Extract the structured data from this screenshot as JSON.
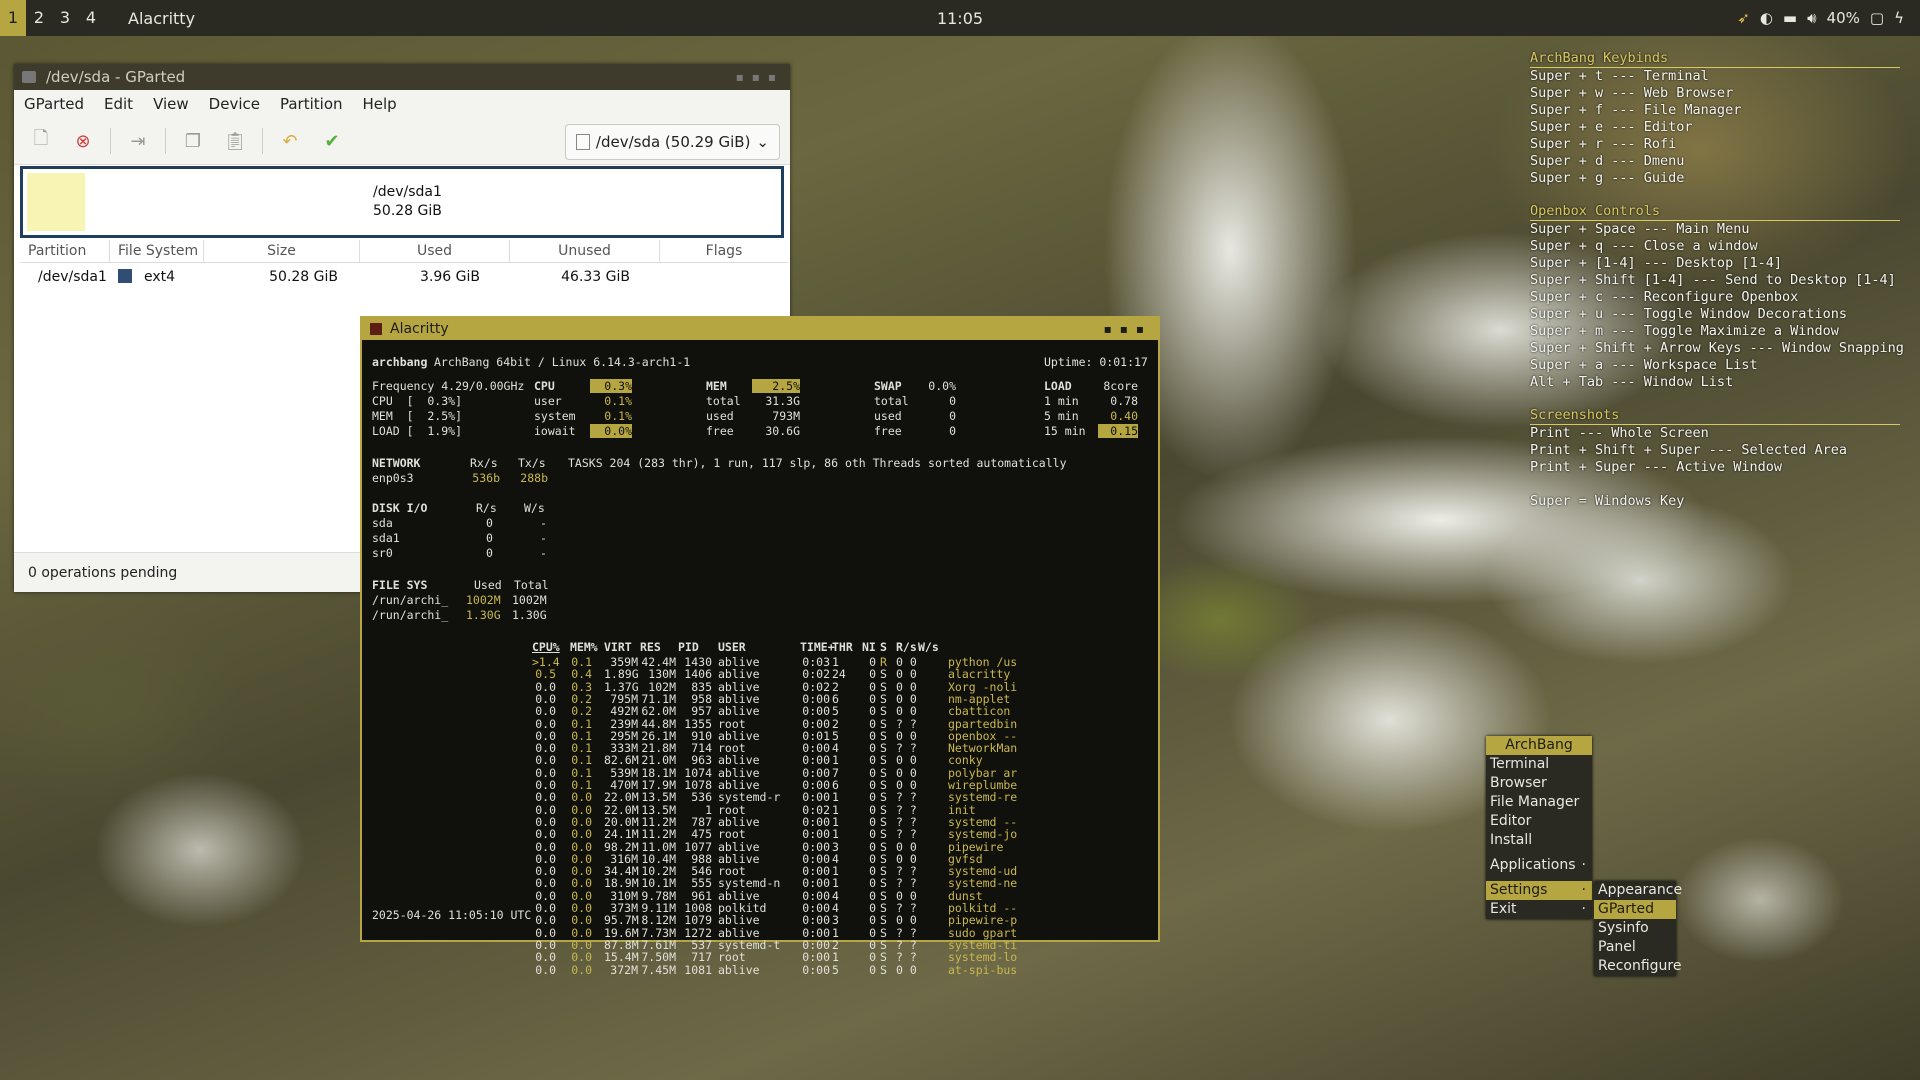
{
  "topbar": {
    "workspaces": [
      "1",
      "2",
      "3",
      "4"
    ],
    "active_workspace": "1",
    "window_title": "Alacritty",
    "clock": "11:05",
    "tray": {
      "battery": "40%"
    }
  },
  "keybinds": {
    "sections": [
      {
        "title": "ArchBang Keybinds",
        "lines": [
          "Super + t --- Terminal",
          "Super + w --- Web Browser",
          "Super + f --- File Manager",
          "Super + e --- Editor",
          "Super + r --- Rofi",
          "Super + d --- Dmenu",
          "Super + g --- Guide"
        ]
      },
      {
        "title": "Openbox Controls",
        "lines": [
          "Super + Space --- Main Menu",
          "Super + q --- Close a window",
          "Super + [1-4] --- Desktop [1-4]",
          "Super + Shift [1-4] --- Send to Desktop [1-4]",
          "Super + c --- Reconfigure Openbox",
          "Super + u --- Toggle Window Decorations",
          "Super + m --- Toggle Maximize a Window",
          "Super + Shift + Arrow Keys --- Window Snapping",
          "Super + a --- Workspace List",
          "Alt + Tab --- Window List"
        ]
      },
      {
        "title": "Screenshots",
        "lines": [
          "Print --- Whole Screen",
          "Print + Shift + Super --- Selected Area",
          "Print + Super  --- Active Window",
          "",
          "Super = Windows Key"
        ]
      }
    ]
  },
  "gparted": {
    "title": "/dev/sda - GParted",
    "menu": [
      "GParted",
      "Edit",
      "View",
      "Device",
      "Partition",
      "Help"
    ],
    "device_select": "/dev/sda (50.29 GiB)",
    "disk_label": {
      "name": "/dev/sda1",
      "size": "50.28 GiB"
    },
    "columns": [
      "Partition",
      "File System",
      "Size",
      "Used",
      "Unused",
      "Flags"
    ],
    "rows": [
      {
        "partition": "/dev/sda1",
        "fs": "ext4",
        "size": "50.28 GiB",
        "used": "3.96 GiB",
        "unused": "46.33 GiB",
        "flags": ""
      }
    ],
    "status": "0 operations pending"
  },
  "terminal": {
    "title": "Alacritty",
    "header_left": "archbang",
    "header_mid": "ArchBang 64bit / Linux 6.14.3-arch1-1",
    "uptime": "Uptime: 0:01:17",
    "summary": {
      "frequency": "Frequency 4.29/0.00GHz",
      "cpu_line": "CPU  [  0.3%]",
      "mem_line": "MEM  [  2.5%]",
      "load_line": "LOAD [  1.9%]",
      "cpu_label": "CPU",
      "cpu_pct": "0.3%",
      "cpu_user_lbl": "user",
      "cpu_user": "0.1%",
      "cpu_system_lbl": "system",
      "cpu_system": "0.1%",
      "cpu_iowait_lbl": "iowait",
      "cpu_iowait": "0.0%",
      "mem_label": "MEM",
      "mem_pct": "2.5%",
      "mem_total_lbl": "total",
      "mem_total": "31.3G",
      "mem_used_lbl": "used",
      "mem_used": "793M",
      "mem_free_lbl": "free",
      "mem_free": "30.6G",
      "swap_label": "SWAP",
      "swap_pct": "0.0%",
      "swap_total_lbl": "total",
      "swap_total": "0",
      "swap_used_lbl": "used",
      "swap_used": "0",
      "swap_free_lbl": "free",
      "swap_free": "0",
      "load_label": "LOAD",
      "load_cores": "8core",
      "load_1_lbl": "1 min",
      "load_1": "0.78",
      "load_5_lbl": "5 min",
      "load_5": "0.40",
      "load_15_lbl": "15 min",
      "load_15": "0.15"
    },
    "network": {
      "label": "NETWORK",
      "rx_h": "Rx/s",
      "tx_h": "Tx/s",
      "iface": "enp0s3",
      "rx": "536b",
      "tx": "288b"
    },
    "tasks": "TASKS 204 (283 thr), 1 run, 117 slp, 86 oth Threads sorted automatically",
    "disk_io": {
      "label": "DISK I/O",
      "r_h": "R/s",
      "w_h": "W/s",
      "rows": [
        [
          "sda",
          "0",
          "-"
        ],
        [
          "sda1",
          "0",
          "-"
        ],
        [
          "sr0",
          "0",
          "-"
        ]
      ]
    },
    "file_sys": {
      "label": "FILE SYS",
      "used_h": "Used",
      "total_h": "Total",
      "rows": [
        [
          "/run/archi_",
          "1002M",
          "1002M"
        ],
        [
          "/run/archi_",
          "1.30G",
          "1.30G"
        ]
      ]
    },
    "proc_headers": [
      "CPU%",
      "MEM%",
      "VIRT",
      "RES",
      "PID",
      "USER",
      "TIME+",
      "THR",
      "NI",
      "S",
      "R/s",
      "W/s"
    ],
    "processes": [
      [
        ">1.4",
        "0.1",
        "359M",
        "42.4M",
        "1430",
        "ablive",
        "0:03",
        "1",
        "0",
        "R",
        "0 0",
        "python /us"
      ],
      [
        "0.5",
        "0.4",
        "1.89G",
        "130M",
        "1406",
        "ablive",
        "0:02",
        "24",
        "0",
        "S",
        "0 0",
        "alacritty"
      ],
      [
        "0.0",
        "0.3",
        "1.37G",
        "102M",
        "835",
        "ablive",
        "0:02",
        "2",
        "0",
        "S",
        "0 0",
        "Xorg -noli"
      ],
      [
        "0.0",
        "0.2",
        "795M",
        "71.1M",
        "958",
        "ablive",
        "0:00",
        "6",
        "0",
        "S",
        "0 0",
        "nm-applet"
      ],
      [
        "0.0",
        "0.2",
        "492M",
        "62.0M",
        "957",
        "ablive",
        "0:00",
        "5",
        "0",
        "S",
        "0 0",
        "cbatticon"
      ],
      [
        "0.0",
        "0.1",
        "239M",
        "44.8M",
        "1355",
        "root",
        "0:00",
        "2",
        "0",
        "S",
        "? ?",
        "gpartedbin"
      ],
      [
        "0.0",
        "0.1",
        "295M",
        "26.1M",
        "910",
        "ablive",
        "0:01",
        "5",
        "0",
        "S",
        "0 0",
        "openbox --"
      ],
      [
        "0.0",
        "0.1",
        "333M",
        "21.8M",
        "714",
        "root",
        "0:00",
        "4",
        "0",
        "S",
        "? ?",
        "NetworkMan"
      ],
      [
        "0.0",
        "0.1",
        "82.6M",
        "21.0M",
        "963",
        "ablive",
        "0:00",
        "1",
        "0",
        "S",
        "0 0",
        "conky"
      ],
      [
        "0.0",
        "0.1",
        "539M",
        "18.1M",
        "1074",
        "ablive",
        "0:00",
        "7",
        "0",
        "S",
        "0 0",
        "polybar ar"
      ],
      [
        "0.0",
        "0.1",
        "470M",
        "17.9M",
        "1078",
        "ablive",
        "0:00",
        "6",
        "0",
        "S",
        "0 0",
        "wireplumbe"
      ],
      [
        "0.0",
        "0.0",
        "22.0M",
        "13.5M",
        "536",
        "systemd-r",
        "0:00",
        "1",
        "0",
        "S",
        "? ?",
        "systemd-re"
      ],
      [
        "0.0",
        "0.0",
        "22.0M",
        "13.5M",
        "1",
        "root",
        "0:02",
        "1",
        "0",
        "S",
        "? ?",
        "init"
      ],
      [
        "0.0",
        "0.0",
        "20.0M",
        "11.2M",
        "787",
        "ablive",
        "0:00",
        "1",
        "0",
        "S",
        "? ?",
        "systemd --"
      ],
      [
        "0.0",
        "0.0",
        "24.1M",
        "11.2M",
        "475",
        "root",
        "0:00",
        "1",
        "0",
        "S",
        "? ?",
        "systemd-jo"
      ],
      [
        "0.0",
        "0.0",
        "98.2M",
        "11.0M",
        "1077",
        "ablive",
        "0:00",
        "3",
        "0",
        "S",
        "0 0",
        "pipewire"
      ],
      [
        "0.0",
        "0.0",
        "316M",
        "10.4M",
        "988",
        "ablive",
        "0:00",
        "4",
        "0",
        "S",
        "0 0",
        "gvfsd"
      ],
      [
        "0.0",
        "0.0",
        "34.4M",
        "10.2M",
        "546",
        "root",
        "0:00",
        "1",
        "0",
        "S",
        "? ?",
        "systemd-ud"
      ],
      [
        "0.0",
        "0.0",
        "18.9M",
        "10.1M",
        "555",
        "systemd-n",
        "0:00",
        "1",
        "0",
        "S",
        "? ?",
        "systemd-ne"
      ],
      [
        "0.0",
        "0.0",
        "310M",
        "9.78M",
        "961",
        "ablive",
        "0:00",
        "4",
        "0",
        "S",
        "0 0",
        "dunst"
      ],
      [
        "0.0",
        "0.0",
        "373M",
        "9.11M",
        "1008",
        "polkitd",
        "0:00",
        "4",
        "0",
        "S",
        "? ?",
        "polkitd --"
      ],
      [
        "0.0",
        "0.0",
        "95.7M",
        "8.12M",
        "1079",
        "ablive",
        "0:00",
        "3",
        "0",
        "S",
        "0 0",
        "pipewire-p"
      ],
      [
        "0.0",
        "0.0",
        "19.6M",
        "7.73M",
        "1272",
        "ablive",
        "0:00",
        "1",
        "0",
        "S",
        "? ?",
        "sudo gpart"
      ],
      [
        "0.0",
        "0.0",
        "87.8M",
        "7.61M",
        "537",
        "systemd-t",
        "0:00",
        "2",
        "0",
        "S",
        "? ?",
        "systemd-ti"
      ],
      [
        "0.0",
        "0.0",
        "15.4M",
        "7.50M",
        "717",
        "root",
        "0:00",
        "1",
        "0",
        "S",
        "? ?",
        "systemd-lo"
      ],
      [
        "0.0",
        "0.0",
        "372M",
        "7.45M",
        "1081",
        "ablive",
        "0:00",
        "5",
        "0",
        "S",
        "0 0",
        "at-spi-bus"
      ]
    ],
    "timestamp": "2025-04-26 11:05:10 UTC"
  },
  "obmenu": {
    "header": "ArchBang",
    "items": [
      "Terminal",
      "Browser",
      "File Manager",
      "Editor",
      "Install"
    ],
    "applications": "Applications",
    "settings": "Settings",
    "exit": "Exit",
    "submenu": [
      "Appearance",
      "GParted",
      "Sysinfo",
      "Panel",
      "Reconfigure"
    ],
    "submenu_active": "GParted"
  },
  "colors": {
    "accent": "#b5a642",
    "bar_bg": "#2a2a22",
    "term_bg": "#10100c",
    "partition_fs": "#304d74",
    "partition_used": "#f8f4b4"
  }
}
